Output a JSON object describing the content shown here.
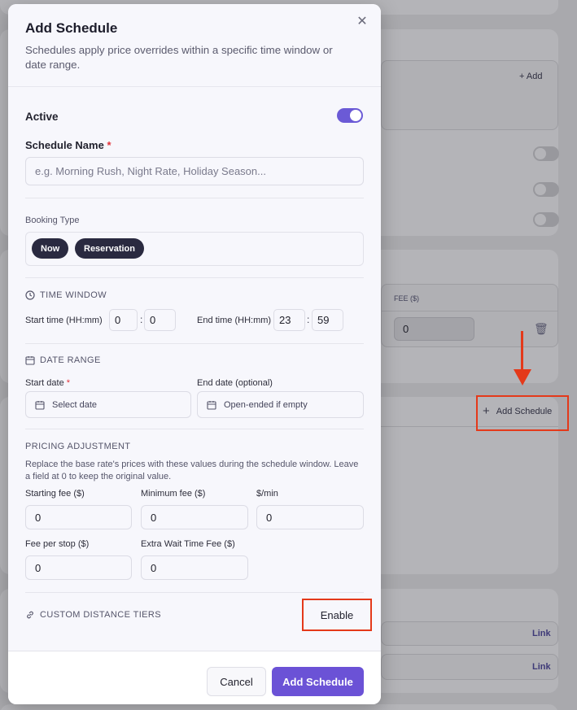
{
  "background": {
    "add_button_label": "Add",
    "fee_column_header": "FEE ($)",
    "fee_value": "0",
    "add_schedule_label": "Add Schedule",
    "link_labels": [
      "Link",
      "Link"
    ]
  },
  "modal": {
    "title": "Add Schedule",
    "description": "Schedules apply price overrides within a specific time window or date range.",
    "active_label": "Active",
    "active_on": true,
    "schedule_name_label": "Schedule Name",
    "required_mark": "*",
    "schedule_name_placeholder": "e.g. Morning Rush, Night Rate, Holiday Season...",
    "booking_type_label": "Booking Type",
    "booking_types": [
      "Now",
      "Reservation"
    ],
    "time_window": {
      "heading": "TIME WINDOW",
      "start_label": "Start time (HH:mm)",
      "start_hour": "0",
      "start_minute": "0",
      "end_label": "End time (HH:mm)",
      "end_hour": "23",
      "end_minute": "59",
      "separator": ":"
    },
    "date_range": {
      "heading": "DATE RANGE",
      "start_label": "Start date",
      "start_placeholder": "Select date",
      "end_label": "End date (optional)",
      "end_placeholder": "Open-ended if empty"
    },
    "pricing": {
      "heading": "PRICING ADJUSTMENT",
      "note": "Replace the base rate's prices with these values during the schedule window. Leave a field at 0 to keep the original value.",
      "fields": [
        {
          "label": "Starting fee ($)",
          "value": "0"
        },
        {
          "label": "Minimum fee ($)",
          "value": "0"
        },
        {
          "label": "$/min",
          "value": "0"
        },
        {
          "label": "Fee per stop ($)",
          "value": "0"
        },
        {
          "label": "Extra Wait Time Fee ($)",
          "value": "0"
        }
      ]
    },
    "distance_tiers": {
      "heading": "CUSTOM DISTANCE TIERS",
      "enable_label": "Enable"
    },
    "footer": {
      "cancel_label": "Cancel",
      "submit_label": "Add Schedule"
    }
  },
  "colors": {
    "accent": "#6b52d6",
    "chip": "#2a2a40",
    "annotation": "#e4391a"
  }
}
